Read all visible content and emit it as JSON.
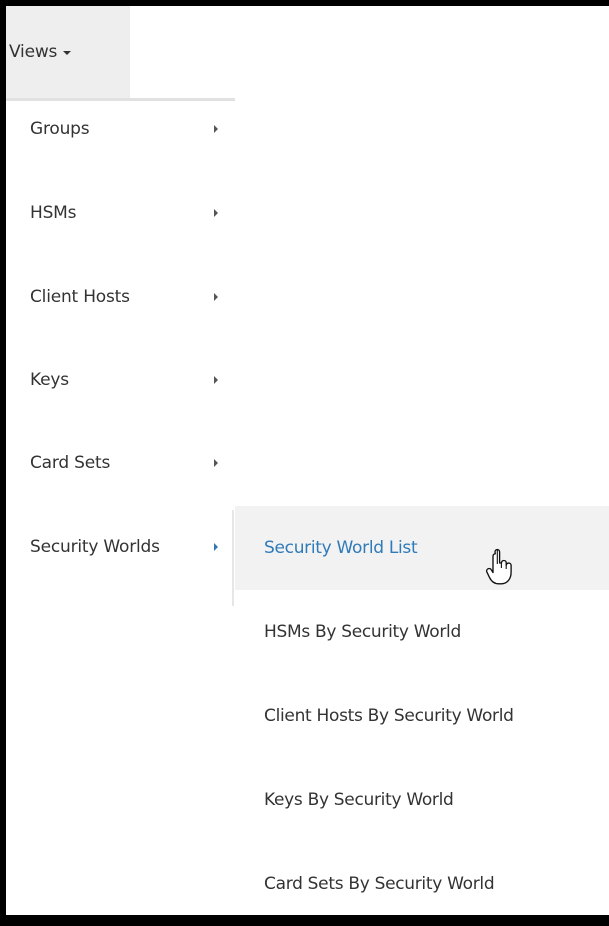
{
  "views_menu": {
    "label": "Views"
  },
  "menu": {
    "items": [
      {
        "label": "Groups"
      },
      {
        "label": "HSMs"
      },
      {
        "label": "Client Hosts"
      },
      {
        "label": "Keys"
      },
      {
        "label": "Card Sets"
      },
      {
        "label": "Security Worlds"
      }
    ]
  },
  "submenu": {
    "items": [
      {
        "label": "Security World List"
      },
      {
        "label": "HSMs By Security World"
      },
      {
        "label": "Client Hosts By Security World"
      },
      {
        "label": "Keys By Security World"
      },
      {
        "label": "Card Sets By Security World"
      }
    ]
  },
  "colors": {
    "accent": "#2f7ab9",
    "highlight_background": "#f2f2f2",
    "button_background": "#eeeeee",
    "text": "#333333"
  },
  "icons": {
    "caret": "caret-down-icon",
    "submenu_arrow": "caret-right-icon",
    "cursor": "pointer-hand-icon"
  }
}
